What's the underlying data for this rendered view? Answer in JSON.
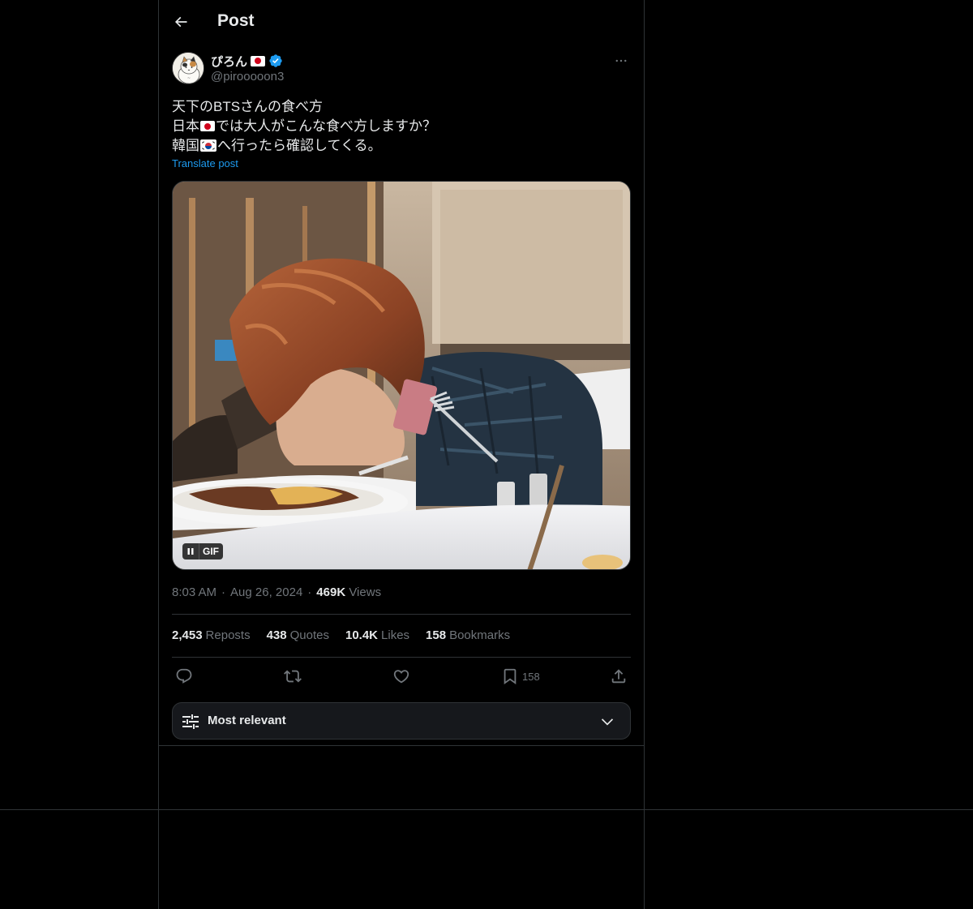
{
  "header": {
    "title": "Post"
  },
  "post": {
    "author": {
      "display_name": "ぴろん",
      "handle": "@pirooooon3",
      "verified": true
    },
    "text_lines": [
      "天下のBTSさんの食べ方",
      "日本🇯🇵では大人がこんな食べ方しますか？",
      "韓国🇰🇷へ行ったら確認してくる。"
    ],
    "text_parts": {
      "line1": "天下のBTSさんの食べ方",
      "line2_a": "日本",
      "line2_b": "では大人がこんな食べ方しますか？",
      "line3_a": "韓国",
      "line3_b": "へ行ったら確認してくる。"
    },
    "translate_label": "Translate post",
    "media": {
      "badge_label": "GIF",
      "icon": "pause-icon"
    },
    "time": "8:03 AM",
    "separator": "·",
    "date": "Aug 26, 2024",
    "views_count": "469K",
    "views_label": "Views"
  },
  "stats": {
    "reposts_count": "2,453",
    "reposts_label": "Reposts",
    "quotes_count": "438",
    "quotes_label": "Quotes",
    "likes_count": "10.4K",
    "likes_label": "Likes",
    "bookmarks_count": "158",
    "bookmarks_label": "Bookmarks"
  },
  "actions": {
    "reply_icon": "reply-icon",
    "repost_icon": "repost-icon",
    "like_icon": "heart-icon",
    "bookmark_icon": "bookmark-icon",
    "bookmark_count": "158",
    "share_icon": "share-icon"
  },
  "sort": {
    "label": "Most relevant",
    "icon": "sliders-icon"
  },
  "colors": {
    "background": "#000000",
    "text": "#e7e9ea",
    "muted": "#71767b",
    "accent": "#1d9bf0",
    "border": "#2f3336"
  }
}
